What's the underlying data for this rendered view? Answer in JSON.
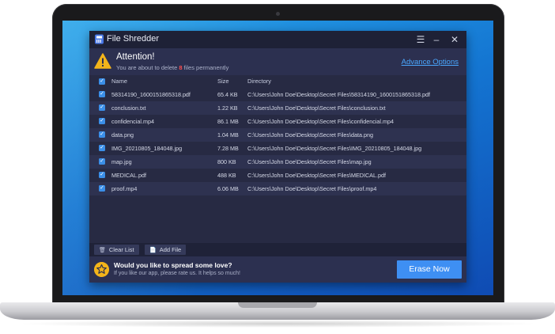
{
  "window": {
    "title": "File Shredder",
    "menu_icon": "hamburger-icon",
    "minimize_icon": "minimize-icon",
    "close_icon": "close-icon"
  },
  "alert": {
    "title": "Attention!",
    "subtitle_before": "You are about to delete ",
    "count": "8",
    "subtitle_after": " files permanently",
    "advanced_link": "Advance Options",
    "icon": "warning-triangle-icon"
  },
  "table": {
    "columns": {
      "name": "Name",
      "size": "Size",
      "directory": "Directory"
    },
    "rows": [
      {
        "name": "58314190_1600151865318.pdf",
        "size": "65.4 KB",
        "directory": "C:\\Users\\John Doe\\Desktop\\Secret Files\\58314190_1600151865318.pdf"
      },
      {
        "name": "conclusion.txt",
        "size": "1.22 KB",
        "directory": "C:\\Users\\John Doe\\Desktop\\Secret Files\\conclusion.txt"
      },
      {
        "name": "confidencial.mp4",
        "size": "86.1 MB",
        "directory": "C:\\Users\\John Doe\\Desktop\\Secret Files\\confidencial.mp4"
      },
      {
        "name": "data.png",
        "size": "1.04 MB",
        "directory": "C:\\Users\\John Doe\\Desktop\\Secret Files\\data.png"
      },
      {
        "name": "IMG_20210805_184048.jpg",
        "size": "7.28 MB",
        "directory": "C:\\Users\\John Doe\\Desktop\\Secret Files\\IMG_20210805_184048.jpg"
      },
      {
        "name": "map.jpg",
        "size": "800 KB",
        "directory": "C:\\Users\\John Doe\\Desktop\\Secret Files\\map.jpg"
      },
      {
        "name": "MEDICAL.pdf",
        "size": "488 KB",
        "directory": "C:\\Users\\John Doe\\Desktop\\Secret Files\\MEDICAL.pdf"
      },
      {
        "name": "proof.mp4",
        "size": "6.06 MB",
        "directory": "C:\\Users\\John Doe\\Desktop\\Secret Files\\proof.mp4"
      }
    ]
  },
  "toolbar": {
    "clear_label": "Clear List",
    "add_label": "Add File",
    "clear_icon": "trash-icon",
    "add_icon": "document-icon"
  },
  "footer": {
    "title": "Would you like to spread some love?",
    "subtitle": "If you like our app, please rate us. It helps so much!",
    "erase_label": "Erase Now",
    "star_icon": "star-icon"
  },
  "colors": {
    "accent": "#3e8ff3",
    "warning": "#f3b41a",
    "danger": "#ff4f4f",
    "window_bg": "#272a43"
  }
}
